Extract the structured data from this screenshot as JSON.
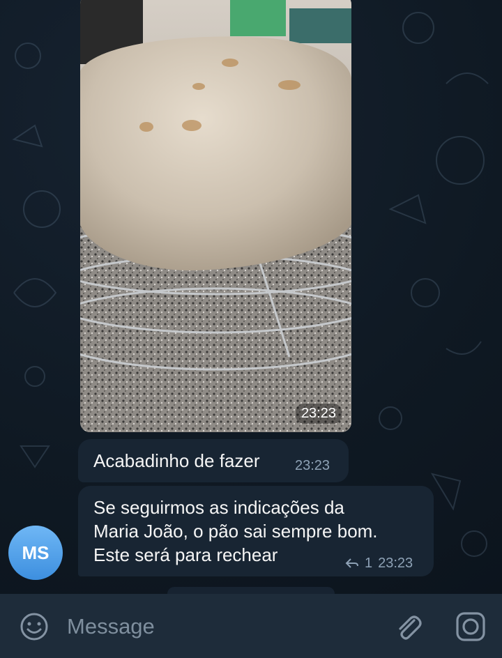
{
  "photo": {
    "time": "23:23",
    "alt_subject": "bread-photo"
  },
  "messages": [
    {
      "text": "Acabadinho de fazer",
      "time": "23:23"
    },
    {
      "lines": [
        "Se seguirmos as indicações da",
        "Maria João, o pão sai sempre bom.",
        "Este será para rechear"
      ],
      "reply_count": "1",
      "time": "23:23"
    }
  ],
  "sender": {
    "initials": "MS"
  },
  "composer": {
    "placeholder": "Message",
    "icons": [
      "emoji-icon",
      "paperclip-icon",
      "camera-icon"
    ]
  },
  "colors": {
    "chat_bg": "#0e1621",
    "bubble": "#182533",
    "composer_bg": "#1e2c3a",
    "meta_text": "#8ea2b6",
    "avatar": "#4a9be6"
  }
}
